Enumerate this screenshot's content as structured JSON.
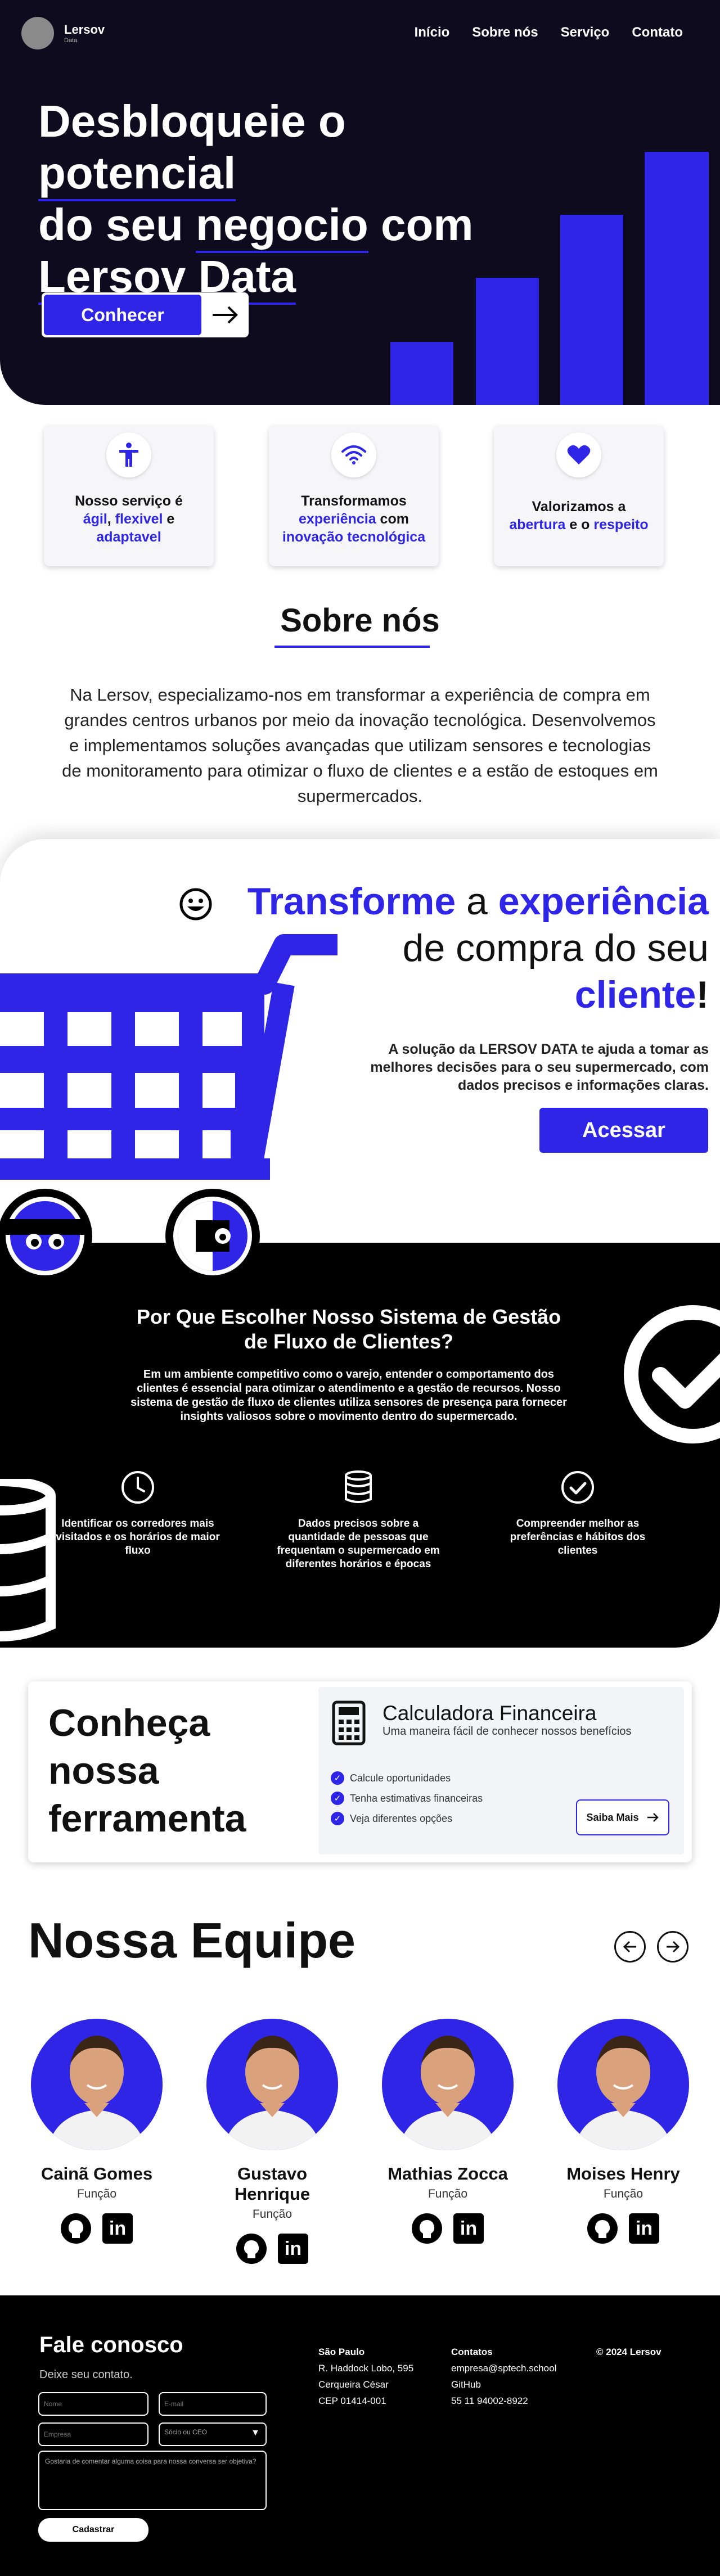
{
  "nav": {
    "brand": "Lersov",
    "brand_sub": "Data",
    "links": [
      "Início",
      "Sobre nós",
      "Serviço",
      "Contato"
    ]
  },
  "hero": {
    "line1_a": "Desbloqueie o ",
    "line1_b": "potencial",
    "line2_a": "do seu ",
    "line2_b": "negocio",
    "line2_c": " com",
    "line3": "Lersov Data",
    "button": "Conhecer"
  },
  "features": [
    {
      "icon": "accessibility-icon",
      "pre": "Nosso serviço é",
      "hl1": "ágil",
      "sep1": ", ",
      "hl2": "flexivel",
      "mid": " e",
      "hl3": "adaptavel",
      "post": ""
    },
    {
      "icon": "wifi-icon",
      "pre": "Transformamos",
      "hl1": "experiência",
      "sep1": " com",
      "hl2": "inovação tecnológica",
      "mid": "",
      "hl3": "",
      "post": ""
    },
    {
      "icon": "heart-icon",
      "pre": "Valorizamos a",
      "hl1": "abertura",
      "sep1": " e o ",
      "hl2": "respeito",
      "mid": "",
      "hl3": "",
      "post": ""
    }
  ],
  "sobre": {
    "title": "Sobre nós",
    "text": "Na Lersov, especializamo-nos em transformar a experiência de compra em grandes centros urbanos por meio da inovação tecnológica. Desenvolvemos e implementamos soluções avançadas que utilizam sensores e tecnologias de monitoramento para otimizar o fluxo de clientes e a estão de estoques em supermercados."
  },
  "transforme": {
    "w1": "Transforme",
    "w2": " a ",
    "w3": "experiência",
    "line2": "de compra do seu",
    "w4": "cliente",
    "w5": "!",
    "sub": "A solução da LERSOV DATA te ajuda a tomar as melhores decisões para o seu supermercado, com dados precisos e informações claras.",
    "button": "Acessar"
  },
  "why": {
    "title": "Por Que Escolher Nosso Sistema de Gestão de Fluxo de Clientes?",
    "text": "Em um ambiente competitivo como o varejo, entender o comportamento dos clientes é essencial para otimizar o atendimento e a gestão de recursos. Nosso sistema de gestão de fluxo de clientes utiliza sensores de presença para fornecer insights valiosos sobre o movimento dentro do supermercado.",
    "items": [
      {
        "icon": "clock-icon",
        "text": "Identificar os corredores mais visitados e os horários de maior fluxo"
      },
      {
        "icon": "database-icon",
        "text": "Dados precisos sobre a quantidade de pessoas que frequentam o supermercado em diferentes horários e épocas"
      },
      {
        "icon": "check-circle-icon",
        "text": "Compreender melhor as preferências e hábitos dos clientes"
      }
    ]
  },
  "tool": {
    "title_1": "Conheça",
    "title_2": "nossa",
    "title_3": "ferramenta",
    "calc_title": "Calculadora Financeira",
    "calc_sub": "Uma maneira fácil de conhecer nossos benefícios",
    "items": [
      "Calcule oportunidades",
      "Tenha estimativas financeiras",
      "Veja diferentes opções"
    ],
    "button": "Saiba Mais"
  },
  "team": {
    "title": "Nossa Equipe",
    "members": [
      {
        "name": "Cainã Gomes",
        "role": "Função"
      },
      {
        "name": "Gustavo Henrique",
        "role": "Função"
      },
      {
        "name": "Mathias Zocca",
        "role": "Função"
      },
      {
        "name": "Moises Henry",
        "role": "Função"
      }
    ]
  },
  "footer": {
    "title": "Fale conosco",
    "subtitle": "Deixe seu contato.",
    "ph_name": "Nome",
    "ph_email": "E-mail",
    "ph_company": "Empresa",
    "ph_role": "Sócio ou CEO",
    "ph_message": "Gostaria de comentar alguma coisa para nossa conversa ser objetiva?",
    "button": "Cadastrar",
    "address_title": "São Paulo",
    "address_1": "R. Haddock Lobo, 595",
    "address_2": "Cerqueira César",
    "address_3": "CEP 01414-001",
    "contact_title": "Contatos",
    "contact_1": "empresa@sptech.school",
    "contact_2": "GitHub",
    "contact_3": "55 11 94002-8922",
    "copyright": "© 2024 Lersov"
  },
  "colors": {
    "accent": "#2e25e6",
    "dark": "#0e0b1f",
    "black": "#000000"
  }
}
